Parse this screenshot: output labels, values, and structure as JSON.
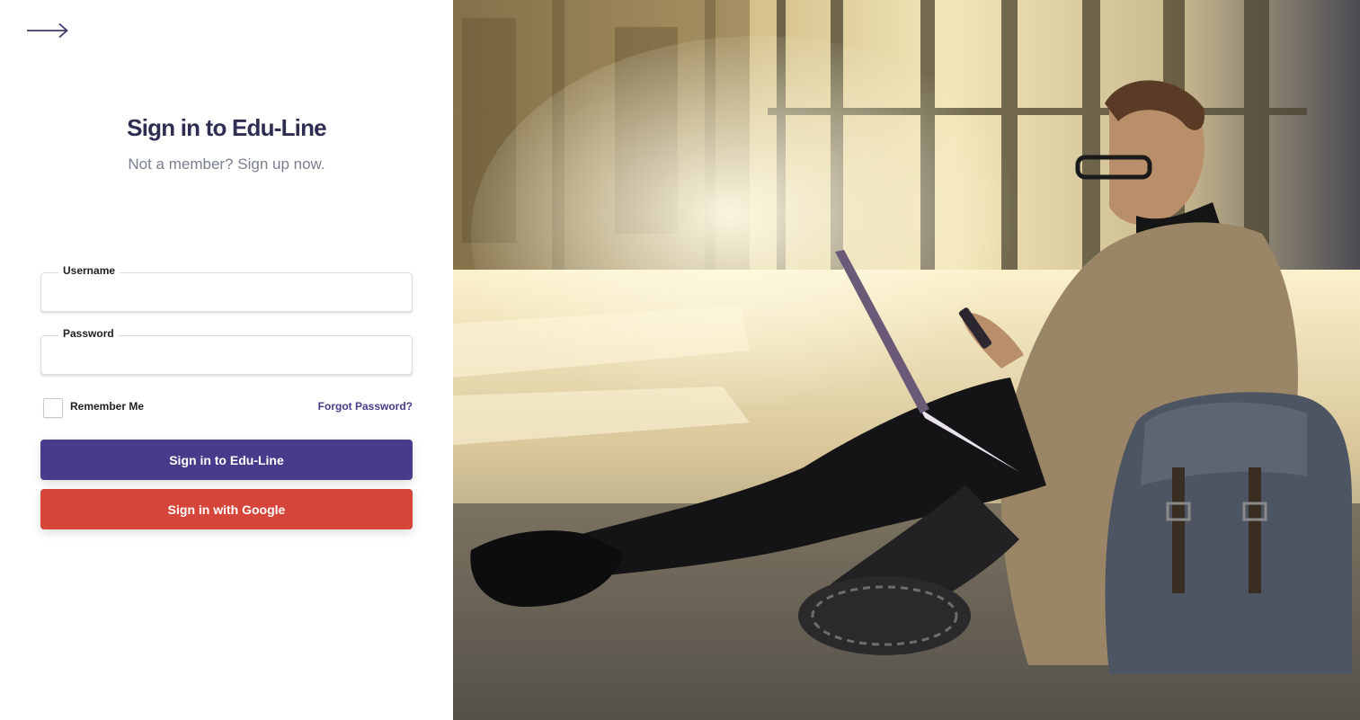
{
  "login": {
    "title": "Sign in to Edu-Line",
    "subtitle": "Not a member? Sign up now.",
    "username": {
      "label": "Username",
      "value": ""
    },
    "password": {
      "label": "Password",
      "value": ""
    },
    "remember_label": "Remember Me",
    "remember_checked": false,
    "forgot_label": "Forgot Password?",
    "primary_button": "Sign in to Edu-Line",
    "google_button": "Sign in with Google"
  },
  "icons": {
    "back": "arrow-right-icon"
  },
  "colors": {
    "title": "#2e2d52",
    "subtitle": "#7a7f8e",
    "primary": "#483b8c",
    "google": "#d64539",
    "link": "#48398a"
  }
}
